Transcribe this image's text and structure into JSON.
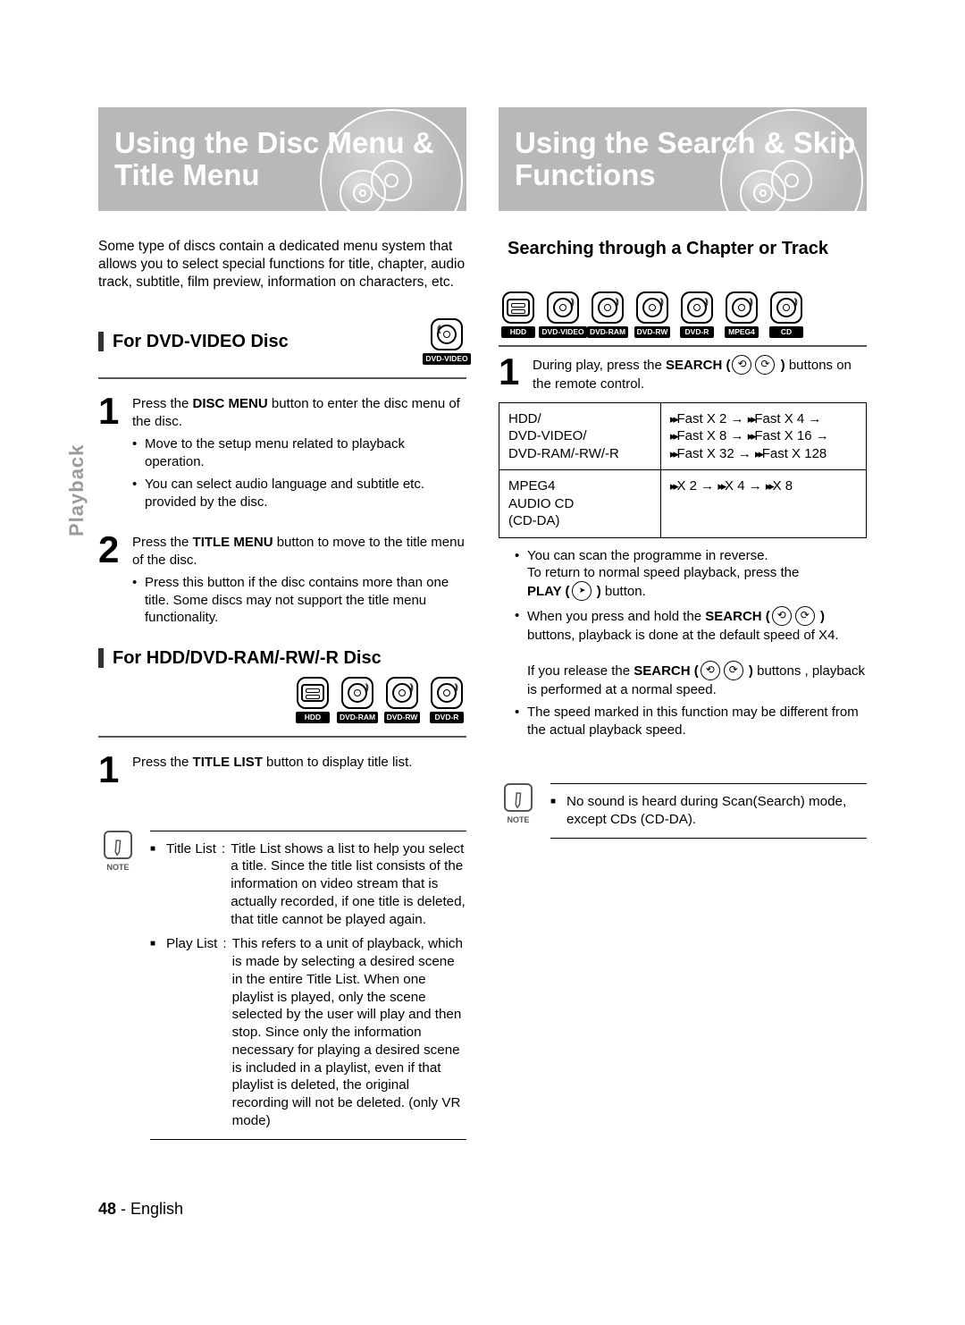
{
  "side_tab": "Playback",
  "footer": {
    "pageno": "48",
    "sep": " - ",
    "lang": "English"
  },
  "left": {
    "title": "Using the Disc Menu & Title Menu",
    "intro": "Some type of discs contain a dedicated menu system that allows you to select special functions for title, chapter, audio track, subtitle, film preview, information on characters, etc.",
    "sec1": {
      "heading": "For DVD-VIDEO Disc",
      "icon": "DVD-VIDEO",
      "step1_pre": "Press the ",
      "step1_bold": "DISC MENU",
      "step1_post": " button to enter the disc menu of the disc.",
      "b1": "Move to the setup menu related to playback operation.",
      "b2": "You can select audio language and subtitle etc. provided by the disc.",
      "step2_pre": "Press the ",
      "step2_bold": "TITLE MENU",
      "step2_post": " button to move to the title menu of the disc.",
      "b3": "Press this button if the disc contains more than one title. Some discs may not support the title menu functionality."
    },
    "sec2": {
      "heading": "For HDD/DVD-RAM/-RW/-R Disc",
      "icons": [
        "HDD",
        "DVD-RAM",
        "DVD-RW",
        "DVD-R"
      ],
      "step1_pre": "Press the ",
      "step1_bold": "TITLE LIST",
      "step1_post": " button to display title list."
    },
    "note": {
      "label": "NOTE",
      "item1_term": "Title List",
      "item1_def": "Title List shows a list to help you select a title. Since the title list consists of the information on video stream that is actually recorded, if one title is deleted, that title cannot be played again.",
      "item2_term": "Play List",
      "item2_def": "This refers to a unit of playback, which is made by selecting a desired scene in the entire Title List. When one playlist is played, only the scene selected by the user will play and then stop. Since only the information necessary for playing a desired scene is included in a playlist, even if that playlist is deleted, the original recording will not be deleted. (only VR mode)"
    }
  },
  "right": {
    "title": "Using the Search & Skip Functions",
    "sec1": {
      "heading": "Searching through a Chapter or Track",
      "icons": [
        "HDD",
        "DVD-VIDEO",
        "DVD-RAM",
        "DVD-RW",
        "DVD-R",
        "MPEG4",
        "CD"
      ],
      "step1a": "During play, press the ",
      "step1b": "SEARCH (",
      "step1c": " ) ",
      "step1d": "buttons on the remote control.",
      "table": {
        "r1a": "HDD/\nDVD-VIDEO/\nDVD-RAM/-RW/-R",
        "r1b": [
          "Fast X 2",
          "Fast X 4",
          "Fast X 8",
          "Fast X 16",
          "Fast X 32",
          "Fast X 128"
        ],
        "r2a": "MPEG4\nAUDIO CD\n(CD-DA)",
        "r2b": [
          "X 2",
          "X 4",
          "X 8"
        ]
      },
      "b1a": "You can scan the programme in reverse.",
      "b1b": "To return to normal speed playback, press the",
      "b1c_pre": "PLAY (",
      "b1c_post": " ) ",
      "b1c_tail": "button.",
      "b2a": "When you press and hold the ",
      "b2b": "SEARCH (",
      "b2c": " )",
      "b2d": " buttons, playback is done at the default speed of X4.",
      "b2e": "If you release the ",
      "b2f": "SEARCH (",
      "b2g": " ) ",
      "b2h": "buttons , playback is performed at a normal speed.",
      "b3": "The speed marked in this function may be different from the actual playback speed."
    },
    "note": {
      "label": "NOTE",
      "item": "No sound is heard during Scan(Search) mode, except CDs (CD-DA)."
    }
  }
}
